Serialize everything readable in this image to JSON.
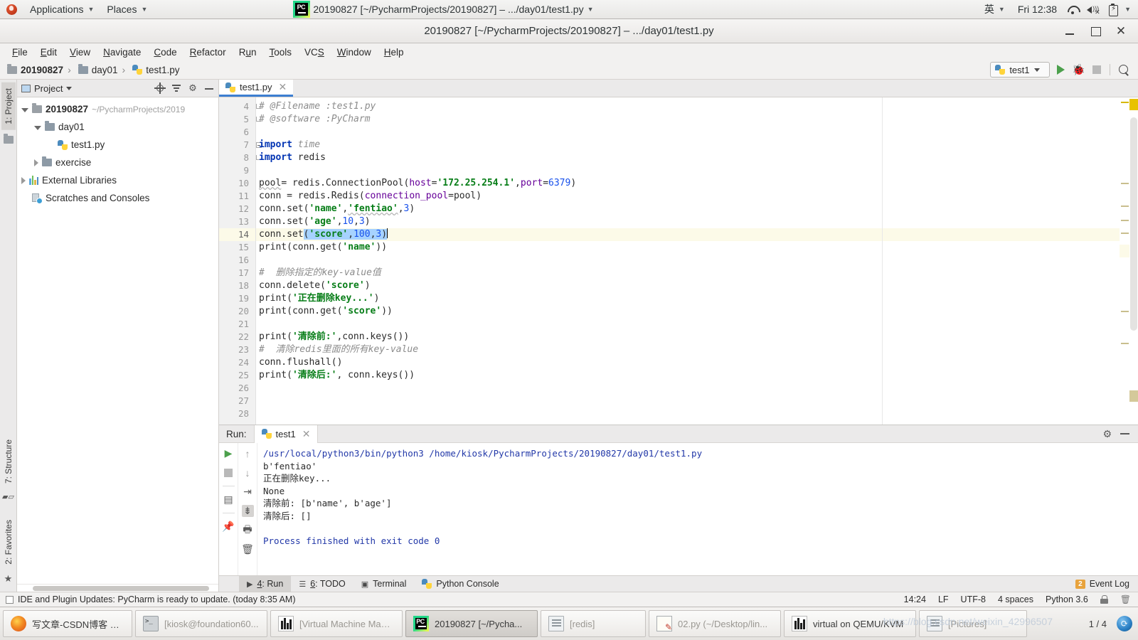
{
  "gnome_panel": {
    "applications": "Applications",
    "places": "Places",
    "window_title": "20190827 [~/PycharmProjects/20190827] – .../day01/test1.py",
    "input_method": "英",
    "clock": "Fri 12:38",
    "icons": [
      "wifi-icon",
      "volume-muted-icon",
      "battery-icon"
    ]
  },
  "window": {
    "title": "20190827 [~/PycharmProjects/20190827] – .../day01/test1.py",
    "buttons": {
      "minimize": "minimize-button",
      "maximize": "maximize-button",
      "close": "close-button"
    }
  },
  "menubar": {
    "items": [
      "File",
      "Edit",
      "View",
      "Navigate",
      "Code",
      "Refactor",
      "Run",
      "Tools",
      "VCS",
      "Window",
      "Help"
    ]
  },
  "navbar": {
    "crumbs": [
      "20190827",
      "day01",
      "test1.py"
    ],
    "run_config": "test1",
    "actions": [
      "run-button",
      "debug-button",
      "stop-button",
      "search-everywhere-button"
    ]
  },
  "left_rail": {
    "top": "1: Project",
    "structure": "7: Structure",
    "favorites": "2: Favorites"
  },
  "project_panel": {
    "title": "Project",
    "header_icons": [
      "locate-icon",
      "collapse-all-icon",
      "settings-gear-icon",
      "hide-icon"
    ],
    "tree": [
      {
        "label": "20190827",
        "path": "~/PycharmProjects/2019",
        "indent": 0,
        "arrow": "open",
        "icon": "folder-icon",
        "bold": true
      },
      {
        "label": "day01",
        "path": "",
        "indent": 1,
        "arrow": "open",
        "icon": "folder-icon",
        "bold": false
      },
      {
        "label": "test1.py",
        "path": "",
        "indent": 2,
        "arrow": "none",
        "icon": "python-file-icon",
        "bold": false
      },
      {
        "label": "exercise",
        "path": "",
        "indent": 1,
        "arrow": "closed",
        "icon": "folder-icon",
        "bold": false
      },
      {
        "label": "External Libraries",
        "path": "",
        "indent": 0,
        "arrow": "closed",
        "icon": "library-icon",
        "bold": false
      },
      {
        "label": "Scratches and Consoles",
        "path": "",
        "indent": 0,
        "arrow": "none",
        "icon": "scratch-icon",
        "bold": false
      }
    ]
  },
  "editor": {
    "tab": "test1.py",
    "first_line_number": 4,
    "current_line": 14,
    "lines": [
      {
        "n": 4,
        "fold": "plain",
        "tokens": [
          {
            "t": "# @Filename :test1.py",
            "c": "cmt"
          }
        ]
      },
      {
        "n": 5,
        "fold": "end",
        "tokens": [
          {
            "t": "# @software :PyCharm",
            "c": "cmt"
          }
        ]
      },
      {
        "n": 6,
        "fold": "",
        "tokens": []
      },
      {
        "n": 7,
        "fold": "start",
        "tokens": [
          {
            "t": "import ",
            "c": "kw"
          },
          {
            "t": "time",
            "c": "cmt"
          }
        ]
      },
      {
        "n": 8,
        "fold": "end",
        "tokens": [
          {
            "t": "import ",
            "c": "kw"
          },
          {
            "t": "redis",
            "c": ""
          }
        ]
      },
      {
        "n": 9,
        "fold": "",
        "tokens": []
      },
      {
        "n": 10,
        "fold": "",
        "tokens": [
          {
            "t": "pool",
            "c": "wavy"
          },
          {
            "t": "= redis.ConnectionPool(",
            "c": ""
          },
          {
            "t": "host",
            "c": "param"
          },
          {
            "t": "=",
            "c": ""
          },
          {
            "t": "'172.25.254.1'",
            "c": "str"
          },
          {
            "t": ",",
            "c": ""
          },
          {
            "t": "port",
            "c": "param"
          },
          {
            "t": "=",
            "c": ""
          },
          {
            "t": "6379",
            "c": "num"
          },
          {
            "t": ")",
            "c": ""
          }
        ]
      },
      {
        "n": 11,
        "fold": "",
        "tokens": [
          {
            "t": "conn = redis.Redis(",
            "c": ""
          },
          {
            "t": "connection_pool",
            "c": "param"
          },
          {
            "t": "=pool)",
            "c": ""
          }
        ]
      },
      {
        "n": 12,
        "fold": "",
        "tokens": [
          {
            "t": "conn.set(",
            "c": ""
          },
          {
            "t": "'name'",
            "c": "str"
          },
          {
            "t": ",",
            "c": ""
          },
          {
            "t": "'fentiao'",
            "c": "str wavy"
          },
          {
            "t": ",",
            "c": ""
          },
          {
            "t": "3",
            "c": "num"
          },
          {
            "t": ")",
            "c": ""
          }
        ]
      },
      {
        "n": 13,
        "fold": "",
        "tokens": [
          {
            "t": "conn.set(",
            "c": ""
          },
          {
            "t": "'age'",
            "c": "str"
          },
          {
            "t": ",",
            "c": ""
          },
          {
            "t": "10",
            "c": "num"
          },
          {
            "t": ",",
            "c": ""
          },
          {
            "t": "3",
            "c": "num"
          },
          {
            "t": ")",
            "c": ""
          }
        ]
      },
      {
        "n": 14,
        "fold": "",
        "tokens": [
          {
            "t": "conn.set",
            "c": ""
          },
          {
            "t": "(",
            "c": "sel"
          },
          {
            "t": "'score'",
            "c": "str sel"
          },
          {
            "t": ",",
            "c": "sel"
          },
          {
            "t": "100",
            "c": "num sel"
          },
          {
            "t": ",",
            "c": "sel"
          },
          {
            "t": "3",
            "c": "num sel"
          },
          {
            "t": ")",
            "c": "sel"
          }
        ],
        "caret": true
      },
      {
        "n": 15,
        "fold": "",
        "tokens": [
          {
            "t": "print(conn.get(",
            "c": ""
          },
          {
            "t": "'name'",
            "c": "str"
          },
          {
            "t": "))",
            "c": ""
          }
        ]
      },
      {
        "n": 16,
        "fold": "",
        "tokens": []
      },
      {
        "n": 17,
        "fold": "",
        "tokens": [
          {
            "t": "#  删除指定的key-value值",
            "c": "cmt"
          }
        ]
      },
      {
        "n": 18,
        "fold": "",
        "tokens": [
          {
            "t": "conn.delete(",
            "c": ""
          },
          {
            "t": "'score'",
            "c": "str"
          },
          {
            "t": ")",
            "c": ""
          }
        ]
      },
      {
        "n": 19,
        "fold": "",
        "tokens": [
          {
            "t": "print(",
            "c": ""
          },
          {
            "t": "'正在删除key...'",
            "c": "str"
          },
          {
            "t": ")",
            "c": ""
          }
        ]
      },
      {
        "n": 20,
        "fold": "",
        "tokens": [
          {
            "t": "print(conn.get(",
            "c": ""
          },
          {
            "t": "'score'",
            "c": "str"
          },
          {
            "t": "))",
            "c": ""
          }
        ]
      },
      {
        "n": 21,
        "fold": "",
        "tokens": []
      },
      {
        "n": 22,
        "fold": "",
        "tokens": [
          {
            "t": "print(",
            "c": ""
          },
          {
            "t": "'清除前:'",
            "c": "str"
          },
          {
            "t": ",conn.keys())",
            "c": ""
          }
        ]
      },
      {
        "n": 23,
        "fold": "",
        "tokens": [
          {
            "t": "#  清除redis里面的所有key-value",
            "c": "cmt"
          }
        ]
      },
      {
        "n": 24,
        "fold": "",
        "tokens": [
          {
            "t": "conn.flushall()",
            "c": ""
          }
        ]
      },
      {
        "n": 25,
        "fold": "",
        "tokens": [
          {
            "t": "print(",
            "c": ""
          },
          {
            "t": "'清除后:'",
            "c": "str"
          },
          {
            "t": ", conn.keys())",
            "c": ""
          }
        ]
      },
      {
        "n": 26,
        "fold": "",
        "tokens": []
      },
      {
        "n": 27,
        "fold": "",
        "tokens": []
      },
      {
        "n": 28,
        "fold": "",
        "tokens": []
      }
    ]
  },
  "run_panel": {
    "label": "Run:",
    "tab": "test1",
    "toolbar_icons": [
      "rerun-icon",
      "stop-icon",
      "restore-layout-icon",
      "pin-icon",
      "up-arrow-icon",
      "down-arrow-icon",
      "soft-wrap-icon",
      "scroll-to-end-icon",
      "print-icon",
      "clear-all-icon"
    ],
    "header_icons": [
      "settings-gear-icon",
      "hide-icon"
    ],
    "output": [
      {
        "text": "/usr/local/python3/bin/python3 /home/kiosk/PycharmProjects/20190827/day01/test1.py",
        "cls": "out-link"
      },
      {
        "text": "b'fentiao'",
        "cls": ""
      },
      {
        "text": "正在删除key...",
        "cls": ""
      },
      {
        "text": "None",
        "cls": ""
      },
      {
        "text": "清除前: [b'name', b'age']",
        "cls": ""
      },
      {
        "text": "清除后: []",
        "cls": ""
      },
      {
        "text": "",
        "cls": ""
      },
      {
        "text": "Process finished with exit code 0",
        "cls": "out-ok"
      }
    ]
  },
  "toolwindow_bar": {
    "items": [
      {
        "label": "4: Run",
        "icon": "run-triangle-icon",
        "active": true
      },
      {
        "label": "6: TODO",
        "icon": "todo-list-icon",
        "active": false
      },
      {
        "label": "Terminal",
        "icon": "terminal-icon",
        "active": false
      },
      {
        "label": "Python Console",
        "icon": "python-icon",
        "active": false
      }
    ],
    "event_log": {
      "label": "Event Log",
      "count": "2"
    }
  },
  "statusbar": {
    "message": "IDE and Plugin Updates: PyCharm is ready to update. (today 8:35 AM)",
    "right": [
      "14:24",
      "LF",
      "UTF-8",
      "4 spaces",
      "Python 3.6"
    ],
    "icons": [
      "lock-icon",
      "trash-icon"
    ]
  },
  "taskbar": {
    "items": [
      {
        "label": "写文章-CSDN博客 – ...",
        "icon": "firefox-icon",
        "state": "normal"
      },
      {
        "label": "[kiosk@foundation60...",
        "icon": "terminal-icon",
        "state": "dim"
      },
      {
        "label": "[Virtual Machine Mana...",
        "icon": "vmm-icon",
        "state": "dim"
      },
      {
        "label": "20190827 [~/Pycha...",
        "icon": "pycharm-icon",
        "state": "active"
      },
      {
        "label": "[redis]",
        "icon": "document-icon",
        "state": "dim"
      },
      {
        "label": "02.py (~/Desktop/lin...",
        "icon": "notepad-icon",
        "state": "dim"
      },
      {
        "label": "virtual on QEMU/KVM",
        "icon": "vmm-icon",
        "state": "normal"
      },
      {
        "label": "[Pictures]",
        "icon": "document-icon",
        "state": "dim"
      }
    ],
    "pager": "1 / 4"
  },
  "watermark": "https://blog.csdn.net/weixin_42996507"
}
